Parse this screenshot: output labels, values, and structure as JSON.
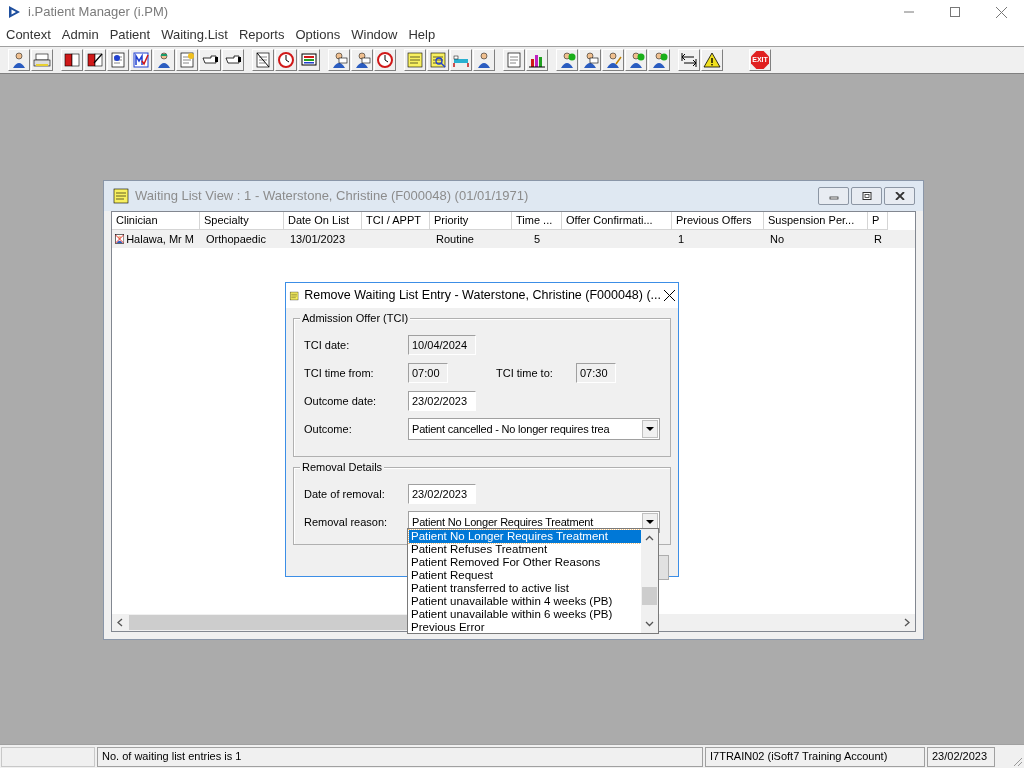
{
  "app": {
    "title": "i.Patient Manager (i.PM)"
  },
  "menu": [
    "Context",
    "Admin",
    "Patient",
    "Waiting.List",
    "Reports",
    "Options",
    "Window",
    "Help"
  ],
  "toolbar": {
    "exit_label": "EXIT"
  },
  "waiting_list_window": {
    "title": "Waiting List View :  1 - Waterstone, Christine (F000048) (01/01/1971)",
    "columns": [
      "Clinician",
      "Specialty",
      "Date On List",
      "TCI / APPT",
      "Priority",
      "Time ...",
      "Offer Confirmati...",
      "Previous Offers",
      "Suspension Per...",
      "P"
    ],
    "rows": [
      {
        "cells": [
          "Halawa, Mr M",
          "Orthopaedic",
          "13/01/2023",
          "",
          "Routine",
          "5",
          "",
          "1",
          "No",
          "R"
        ]
      }
    ]
  },
  "dialog": {
    "title": "Remove Waiting List Entry - Waterstone, Christine (F000048) (...",
    "admission_offer": {
      "heading": "Admission Offer (TCI)",
      "tci_date": {
        "label": "TCI date:",
        "value": "10/04/2024",
        "disabled": true
      },
      "tci_time_from": {
        "label": "TCI time from:",
        "value": "07:00",
        "disabled": true
      },
      "tci_time_to": {
        "label": "TCI time to:",
        "value": "07:30",
        "disabled": true
      },
      "outcome_date": {
        "label": "Outcome date:",
        "value": "23/02/2023",
        "disabled": false
      },
      "outcome": {
        "label": "Outcome:",
        "value": "Patient cancelled - No longer requires trea"
      }
    },
    "removal_details": {
      "heading": "Removal Details",
      "date_of_removal": {
        "label": "Date of removal:",
        "value": "23/02/2023",
        "disabled": false
      },
      "removal_reason": {
        "label": "Removal reason:",
        "value": "Patient No Longer Requires Treatment",
        "expanded": true
      }
    },
    "reason_list": [
      {
        "label": "Patient No Longer Requires Treatment",
        "selected": true
      },
      {
        "label": "Patient Refuses Treatment",
        "selected": false
      },
      {
        "label": "Patient Removed For Other Reasons",
        "selected": false
      },
      {
        "label": "Patient Request",
        "selected": false
      },
      {
        "label": "Patient transferred to active list",
        "selected": false
      },
      {
        "label": "Patient unavailable within 4 weeks (PB)",
        "selected": false
      },
      {
        "label": "Patient unavailable within 6 weeks (PB)",
        "selected": false
      },
      {
        "label": "Previous Error",
        "selected": false
      }
    ]
  },
  "status_bar": [
    "No. of waiting list entries is 1",
    "I7TRAIN02 (iSoft7 Training Account)",
    "23/02/2023"
  ]
}
